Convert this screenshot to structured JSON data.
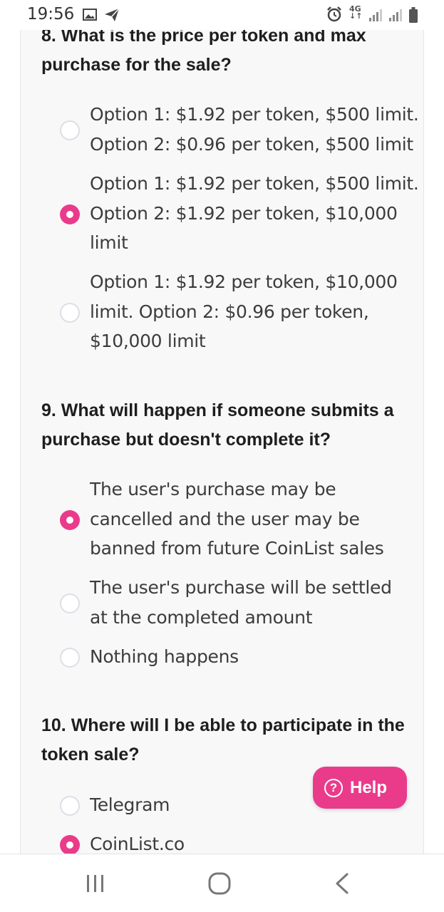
{
  "status_bar": {
    "time": "19:56",
    "network": "4G",
    "icons": [
      "gallery-icon",
      "send-icon",
      "alarm-icon",
      "signal-icon",
      "battery-icon"
    ]
  },
  "colors": {
    "accent": "#ea3b8b",
    "text": "#3c3c3c",
    "question": "#1e1e1e",
    "card_bg": "#f8f8f8"
  },
  "questions": [
    {
      "title": "8. What is the price per token and max purchase for the sale?",
      "options": [
        {
          "lines": [
            "Option 1: $1.92 per token, $500 limit.",
            "Option 2: $0.96 per token, $500 limit"
          ],
          "selected": false
        },
        {
          "lines": [
            "Option 1: $1.92 per token, $500 limit.",
            "Option 2: $1.92 per token, $10,000",
            "limit"
          ],
          "selected": true
        },
        {
          "lines": [
            "Option 1: $1.92 per token, $10,000",
            "limit. Option 2: $0.96 per token,",
            "$10,000 limit"
          ],
          "selected": false
        }
      ]
    },
    {
      "title": "9. What will happen if someone submits a purchase but doesn't complete it?",
      "options": [
        {
          "lines": [
            "The user's purchase may be",
            "cancelled and the user may be",
            "banned from future CoinList sales"
          ],
          "selected": true
        },
        {
          "lines": [
            "The user's purchase will be settled",
            "at the completed amount"
          ],
          "selected": false
        },
        {
          "lines": [
            "Nothing happens"
          ],
          "selected": false
        }
      ]
    },
    {
      "title": "10. Where will I be able to participate in the token sale?",
      "options": [
        {
          "lines": [
            "Telegram"
          ],
          "selected": false
        },
        {
          "lines": [
            "CoinList.co"
          ],
          "selected": true
        }
      ]
    }
  ],
  "help_button": {
    "label": "Help",
    "icon": "question-circle-icon"
  },
  "nav_bar": {
    "buttons": [
      "recents-icon",
      "home-icon",
      "back-icon"
    ]
  }
}
